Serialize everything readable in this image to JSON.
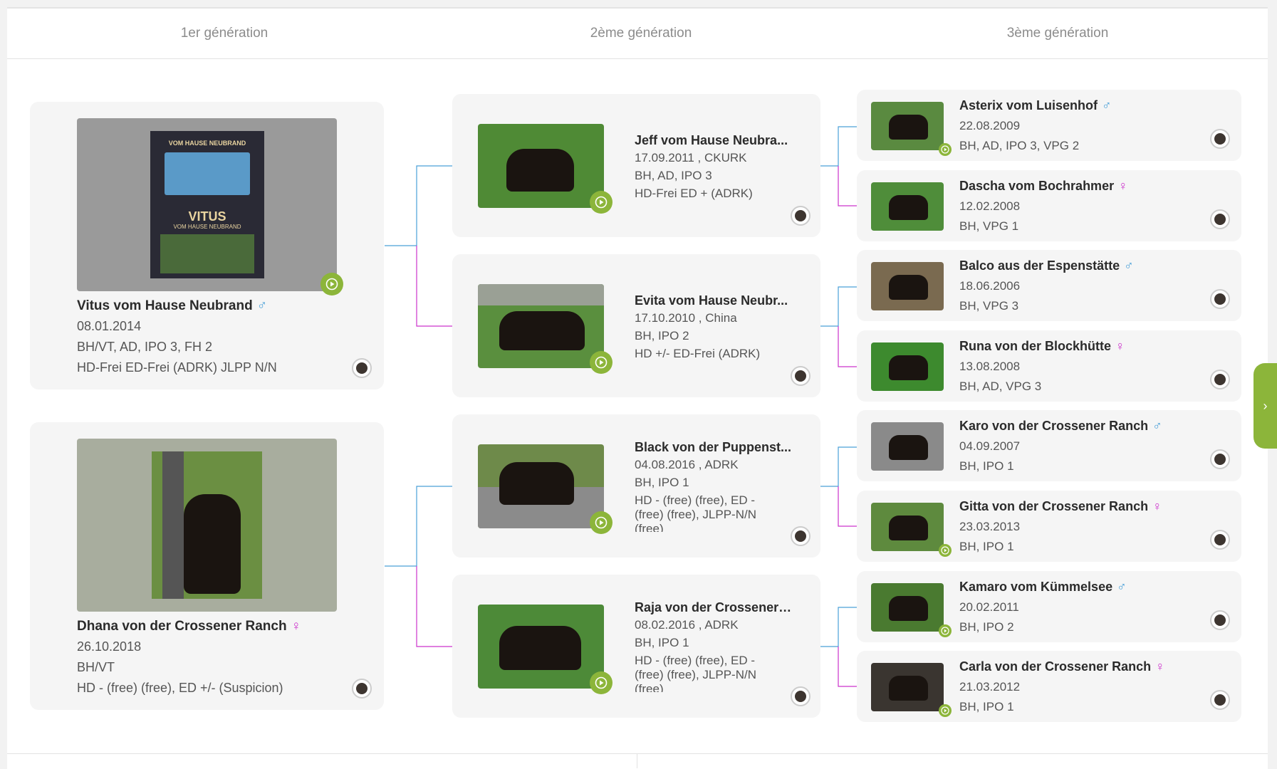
{
  "headers": [
    "1er génération",
    "2ème génération",
    "3ème génération"
  ],
  "gen1": [
    {
      "name": "Vitus vom Hause Neubrand",
      "sex": "♂",
      "sex_type": "male",
      "lines": [
        "08.01.2014",
        "BH/VT, AD, IPO 3, FH 2",
        "HD-Frei ED-Frei (ADRK) JLPP N/N"
      ],
      "photo_caption_top": "VOM HAUSE NEUBRAND",
      "photo_caption_mid": "VITUS",
      "photo_caption_sub": "VOM HAUSE NEUBRAND"
    },
    {
      "name": "Dhana von der Crossener Ranch",
      "sex": "♀",
      "sex_type": "female",
      "lines": [
        "26.10.2018",
        "BH/VT",
        "HD - (free) (free), ED +/- (Suspicion)"
      ]
    }
  ],
  "gen2": [
    {
      "name": "Jeff vom Hause Neubra...",
      "lines": [
        "17.09.2011 , CKURK",
        "BH, AD, IPO 3",
        "HD-Frei ED + (ADRK)"
      ]
    },
    {
      "name": "Evita vom Hause Neubr...",
      "lines": [
        "17.10.2010 , China",
        "BH, IPO 2",
        "HD +/- ED-Frei (ADRK)"
      ]
    },
    {
      "name": "Black von der Puppenst...",
      "lines": [
        "04.08.2016 , ADRK",
        "BH, IPO 1",
        "HD - (free) (free), ED -",
        "(free) (free), JLPP-N/N",
        "(free)"
      ]
    },
    {
      "name": "Raja von der Crossener ...",
      "lines": [
        "08.02.2016 , ADRK",
        "BH, IPO 1",
        "HD - (free) (free), ED -",
        "(free) (free), JLPP-N/N",
        "(free)"
      ]
    }
  ],
  "gen3": [
    {
      "name": "Asterix vom Luisenhof",
      "sex": "♂",
      "sex_type": "male",
      "lines": [
        "22.08.2009",
        "BH, AD, IPO 3, VPG 2"
      ],
      "video": true
    },
    {
      "name": "Dascha vom Bochrahmer",
      "sex": "♀",
      "sex_type": "female",
      "lines": [
        "12.02.2008",
        "BH, VPG 1"
      ],
      "video": false
    },
    {
      "name": "Balco aus der Espenstätte",
      "sex": "♂",
      "sex_type": "male",
      "lines": [
        "18.06.2006",
        "BH, VPG 3"
      ],
      "video": false
    },
    {
      "name": "Runa von der Blockhütte",
      "sex": "♀",
      "sex_type": "female",
      "lines": [
        "13.08.2008",
        "BH, AD, VPG 3"
      ],
      "video": false
    },
    {
      "name": "Karo von der Crossener Ranch",
      "sex": "♂",
      "sex_type": "male",
      "lines": [
        "04.09.2007",
        "BH, IPO 1"
      ],
      "video": false
    },
    {
      "name": "Gitta von der Crossener Ranch",
      "sex": "♀",
      "sex_type": "female",
      "lines": [
        "23.03.2013",
        "BH, IPO 1"
      ],
      "video": true
    },
    {
      "name": "Kamaro vom Kümmelsee",
      "sex": "♂",
      "sex_type": "male",
      "lines": [
        "20.02.2011",
        "BH, IPO 2"
      ],
      "video": true
    },
    {
      "name": "Carla von der Crossener Ranch",
      "sex": "♀",
      "sex_type": "female",
      "lines": [
        "21.03.2012",
        "BH, IPO 1"
      ],
      "video": true
    }
  ],
  "side_tab_icon": "chevron-right-icon",
  "side_tab_glyph": "›",
  "colors": {
    "male": "#4aa0d8",
    "female": "#cc33cc",
    "accent": "#8cb53a"
  }
}
